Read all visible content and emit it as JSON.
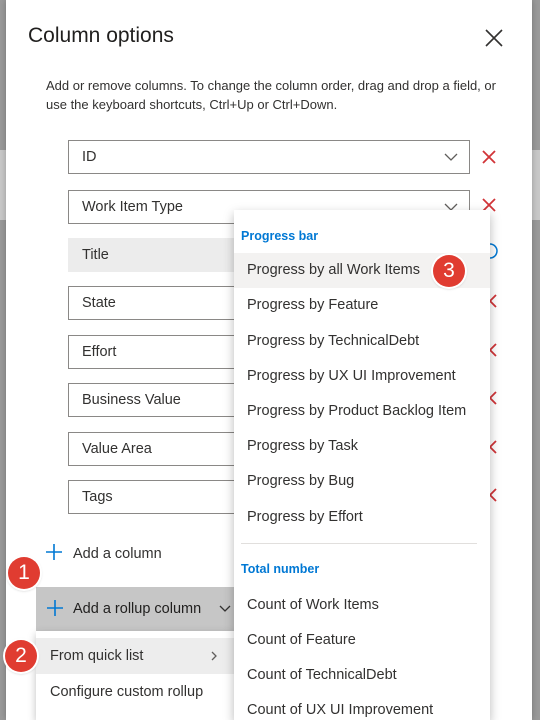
{
  "dialog": {
    "title": "Column options",
    "close_icon": "close-icon",
    "intro": "Add or remove columns. To change the column order, drag and drop a field, or use the keyboard shortcuts, Ctrl+Up or Ctrl+Down."
  },
  "columns": [
    {
      "label": "ID"
    },
    {
      "label": "Work Item Type"
    },
    {
      "label": "Title"
    },
    {
      "label": "State"
    },
    {
      "label": "Effort"
    },
    {
      "label": "Business Value"
    },
    {
      "label": "Value Area"
    },
    {
      "label": "Tags"
    }
  ],
  "actions": {
    "add_column": "Add a column",
    "add_rollup": "Add a rollup column"
  },
  "rollup_menu": {
    "items": [
      "From quick list",
      "Configure custom rollup"
    ]
  },
  "quick_list": {
    "progress_header": "Progress bar",
    "progress_items": [
      "Progress by all Work Items",
      "Progress by Feature",
      "Progress by TechnicalDebt",
      "Progress by UX UI Improvement",
      "Progress by Product Backlog Item",
      "Progress by Task",
      "Progress by Bug",
      "Progress by Effort"
    ],
    "total_header": "Total number",
    "total_items": [
      "Count of Work Items",
      "Count of Feature",
      "Count of TechnicalDebt",
      "Count of UX UI Improvement"
    ]
  },
  "callouts": [
    "1",
    "2",
    "3"
  ],
  "colors": {
    "remove": "#d13438",
    "accent": "#0078d4",
    "callout": "#e03c31"
  }
}
